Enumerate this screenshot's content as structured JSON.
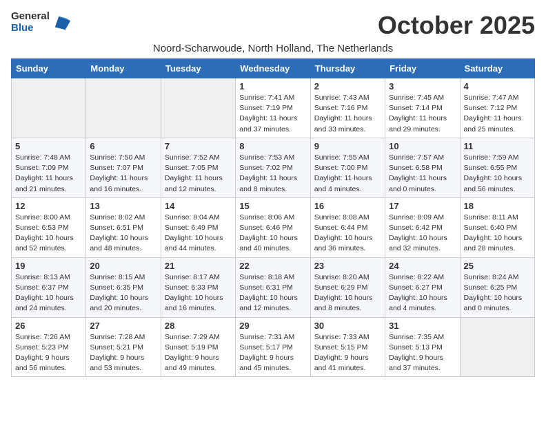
{
  "header": {
    "logo_general": "General",
    "logo_blue": "Blue",
    "title": "October 2025",
    "subtitle": "Noord-Scharwoude, North Holland, The Netherlands"
  },
  "weekdays": [
    "Sunday",
    "Monday",
    "Tuesday",
    "Wednesday",
    "Thursday",
    "Friday",
    "Saturday"
  ],
  "weeks": [
    [
      {
        "day": "",
        "empty": true
      },
      {
        "day": "",
        "empty": true
      },
      {
        "day": "",
        "empty": true
      },
      {
        "day": "1",
        "sunrise": "7:41 AM",
        "sunset": "7:19 PM",
        "daylight": "11 hours and 37 minutes."
      },
      {
        "day": "2",
        "sunrise": "7:43 AM",
        "sunset": "7:16 PM",
        "daylight": "11 hours and 33 minutes."
      },
      {
        "day": "3",
        "sunrise": "7:45 AM",
        "sunset": "7:14 PM",
        "daylight": "11 hours and 29 minutes."
      },
      {
        "day": "4",
        "sunrise": "7:47 AM",
        "sunset": "7:12 PM",
        "daylight": "11 hours and 25 minutes."
      }
    ],
    [
      {
        "day": "5",
        "sunrise": "7:48 AM",
        "sunset": "7:09 PM",
        "daylight": "11 hours and 21 minutes."
      },
      {
        "day": "6",
        "sunrise": "7:50 AM",
        "sunset": "7:07 PM",
        "daylight": "11 hours and 16 minutes."
      },
      {
        "day": "7",
        "sunrise": "7:52 AM",
        "sunset": "7:05 PM",
        "daylight": "11 hours and 12 minutes."
      },
      {
        "day": "8",
        "sunrise": "7:53 AM",
        "sunset": "7:02 PM",
        "daylight": "11 hours and 8 minutes."
      },
      {
        "day": "9",
        "sunrise": "7:55 AM",
        "sunset": "7:00 PM",
        "daylight": "11 hours and 4 minutes."
      },
      {
        "day": "10",
        "sunrise": "7:57 AM",
        "sunset": "6:58 PM",
        "daylight": "11 hours and 0 minutes."
      },
      {
        "day": "11",
        "sunrise": "7:59 AM",
        "sunset": "6:55 PM",
        "daylight": "10 hours and 56 minutes."
      }
    ],
    [
      {
        "day": "12",
        "sunrise": "8:00 AM",
        "sunset": "6:53 PM",
        "daylight": "10 hours and 52 minutes."
      },
      {
        "day": "13",
        "sunrise": "8:02 AM",
        "sunset": "6:51 PM",
        "daylight": "10 hours and 48 minutes."
      },
      {
        "day": "14",
        "sunrise": "8:04 AM",
        "sunset": "6:49 PM",
        "daylight": "10 hours and 44 minutes."
      },
      {
        "day": "15",
        "sunrise": "8:06 AM",
        "sunset": "6:46 PM",
        "daylight": "10 hours and 40 minutes."
      },
      {
        "day": "16",
        "sunrise": "8:08 AM",
        "sunset": "6:44 PM",
        "daylight": "10 hours and 36 minutes."
      },
      {
        "day": "17",
        "sunrise": "8:09 AM",
        "sunset": "6:42 PM",
        "daylight": "10 hours and 32 minutes."
      },
      {
        "day": "18",
        "sunrise": "8:11 AM",
        "sunset": "6:40 PM",
        "daylight": "10 hours and 28 minutes."
      }
    ],
    [
      {
        "day": "19",
        "sunrise": "8:13 AM",
        "sunset": "6:37 PM",
        "daylight": "10 hours and 24 minutes."
      },
      {
        "day": "20",
        "sunrise": "8:15 AM",
        "sunset": "6:35 PM",
        "daylight": "10 hours and 20 minutes."
      },
      {
        "day": "21",
        "sunrise": "8:17 AM",
        "sunset": "6:33 PM",
        "daylight": "10 hours and 16 minutes."
      },
      {
        "day": "22",
        "sunrise": "8:18 AM",
        "sunset": "6:31 PM",
        "daylight": "10 hours and 12 minutes."
      },
      {
        "day": "23",
        "sunrise": "8:20 AM",
        "sunset": "6:29 PM",
        "daylight": "10 hours and 8 minutes."
      },
      {
        "day": "24",
        "sunrise": "8:22 AM",
        "sunset": "6:27 PM",
        "daylight": "10 hours and 4 minutes."
      },
      {
        "day": "25",
        "sunrise": "8:24 AM",
        "sunset": "6:25 PM",
        "daylight": "10 hours and 0 minutes."
      }
    ],
    [
      {
        "day": "26",
        "sunrise": "7:26 AM",
        "sunset": "5:23 PM",
        "daylight": "9 hours and 56 minutes."
      },
      {
        "day": "27",
        "sunrise": "7:28 AM",
        "sunset": "5:21 PM",
        "daylight": "9 hours and 53 minutes."
      },
      {
        "day": "28",
        "sunrise": "7:29 AM",
        "sunset": "5:19 PM",
        "daylight": "9 hours and 49 minutes."
      },
      {
        "day": "29",
        "sunrise": "7:31 AM",
        "sunset": "5:17 PM",
        "daylight": "9 hours and 45 minutes."
      },
      {
        "day": "30",
        "sunrise": "7:33 AM",
        "sunset": "5:15 PM",
        "daylight": "9 hours and 41 minutes."
      },
      {
        "day": "31",
        "sunrise": "7:35 AM",
        "sunset": "5:13 PM",
        "daylight": "9 hours and 37 minutes."
      },
      {
        "day": "",
        "empty": true
      }
    ]
  ]
}
